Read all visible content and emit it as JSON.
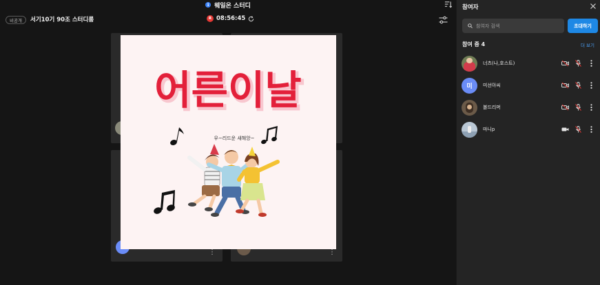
{
  "app": {
    "title": "웨일온 스터디"
  },
  "room": {
    "badge": "비공개",
    "title": "서기10기 90조 스터디룸",
    "rec_label": "R",
    "timer": "08:56:45"
  },
  "shared_image": {
    "headline": "어른이날",
    "caption": "우~리드운 새해앙~"
  },
  "panel": {
    "title": "참여자",
    "search_placeholder": "참여자 검색",
    "invite_label": "초대하기",
    "count_label": "참여 중 4",
    "more_label": "더 보기",
    "participants": [
      {
        "name": "너츠(나,호스트)",
        "video": "off",
        "mic": "off"
      },
      {
        "name": "미선아씨",
        "initial": "미",
        "video": "off",
        "mic": "off"
      },
      {
        "name": "볼드리머",
        "video": "off",
        "mic": "off"
      },
      {
        "name": "마니p",
        "video": "on",
        "mic": "off"
      }
    ]
  },
  "colors": {
    "accent": "#1e88e5",
    "headline_red": "#e3203a",
    "avatar_blue": "#6a8cf7",
    "mute_red": "#e53935"
  },
  "icons": [
    "info-icon",
    "sort-icon",
    "record-icon",
    "refresh-icon",
    "settings-icon",
    "close-icon",
    "search-icon",
    "video-off-icon",
    "video-icon",
    "mic-off-icon",
    "more-icon",
    "music-note-icon"
  ]
}
